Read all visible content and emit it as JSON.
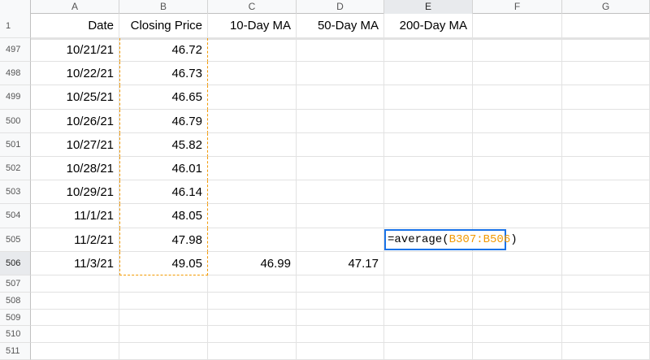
{
  "columns": [
    "A",
    "B",
    "C",
    "D",
    "E",
    "F",
    "G"
  ],
  "selected_column": "E",
  "header_row": {
    "row_number": "1",
    "cells": [
      "Date",
      "Closing Price",
      "10-Day MA",
      "50-Day MA",
      "200-Day MA",
      "",
      ""
    ]
  },
  "rows": [
    {
      "n": "497",
      "date": "10/21/21",
      "price": "46.72",
      "ma10": "",
      "ma50": ""
    },
    {
      "n": "498",
      "date": "10/22/21",
      "price": "46.73",
      "ma10": "",
      "ma50": ""
    },
    {
      "n": "499",
      "date": "10/25/21",
      "price": "46.65",
      "ma10": "",
      "ma50": ""
    },
    {
      "n": "500",
      "date": "10/26/21",
      "price": "46.79",
      "ma10": "",
      "ma50": ""
    },
    {
      "n": "501",
      "date": "10/27/21",
      "price": "45.82",
      "ma10": "",
      "ma50": ""
    },
    {
      "n": "502",
      "date": "10/28/21",
      "price": "46.01",
      "ma10": "",
      "ma50": ""
    },
    {
      "n": "503",
      "date": "10/29/21",
      "price": "46.14",
      "ma10": "",
      "ma50": ""
    },
    {
      "n": "504",
      "date": "11/1/21",
      "price": "48.05",
      "ma10": "",
      "ma50": ""
    },
    {
      "n": "505",
      "date": "11/2/21",
      "price": "47.98",
      "ma10": "",
      "ma50": ""
    },
    {
      "n": "506",
      "date": "11/3/21",
      "price": "49.05",
      "ma10": "46.99",
      "ma50": "47.17"
    }
  ],
  "empty_rows": [
    "507",
    "508",
    "509",
    "510",
    "511"
  ],
  "active_cell": {
    "ref": "E506",
    "formula_prefix": "=average(",
    "formula_range": "B307:B506",
    "formula_suffix": ")"
  },
  "colors": {
    "selection": "#1a73e8",
    "copy_range": "#f29900",
    "header_bg": "#f8f9fa"
  }
}
